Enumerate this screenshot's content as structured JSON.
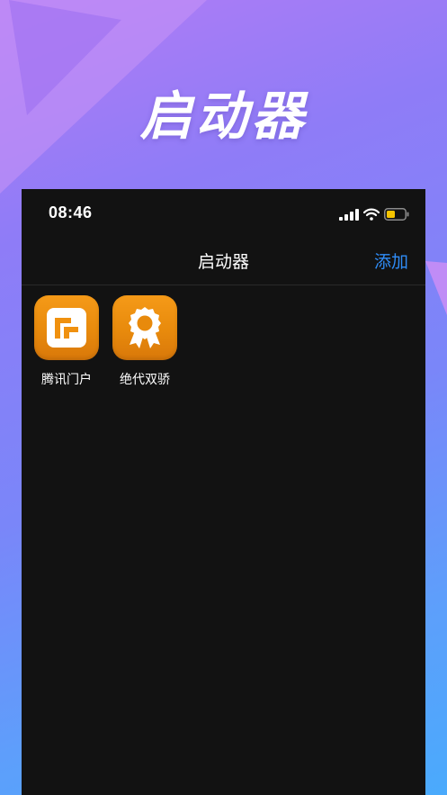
{
  "banner": {
    "title": "启动器"
  },
  "status_bar": {
    "time": "08:46",
    "icons": [
      "signal-icon",
      "wifi-icon",
      "battery-icon"
    ],
    "battery_color": "#f5c400"
  },
  "nav": {
    "title": "启动器",
    "action_label": "添加",
    "action_color": "#2f8cf6"
  },
  "apps": [
    {
      "label": "腾讯门户",
      "icon": "tencent-portal-icon"
    },
    {
      "label": "绝代双骄",
      "icon": "award-ribbon-icon"
    }
  ],
  "colors": {
    "app_icon": "#f0910f",
    "screen_bg": "#121212",
    "page_gradient_top": "#b27cf5",
    "page_gradient_bottom": "#4aaafc"
  }
}
